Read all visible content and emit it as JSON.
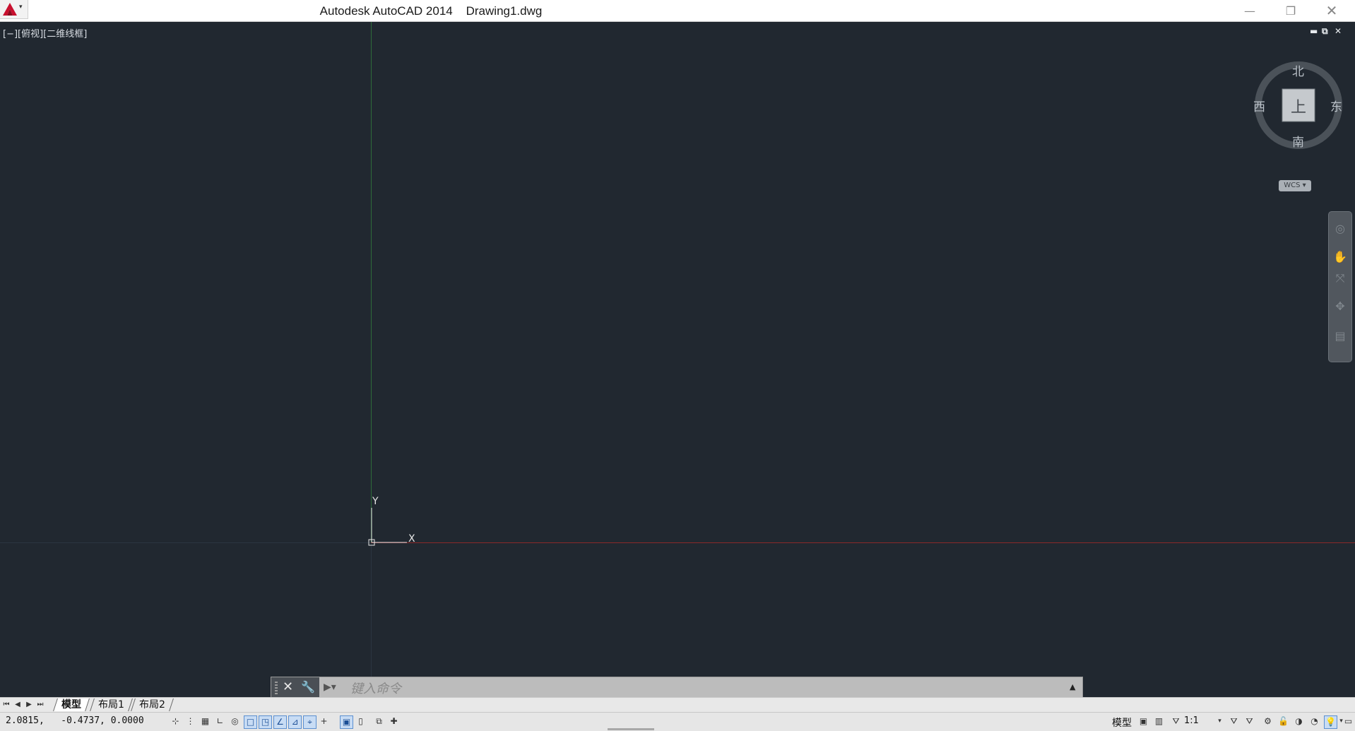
{
  "titlebar": {
    "app_name": "Autodesk AutoCAD 2014",
    "file_name": "Drawing1.dwg",
    "title": "Autodesk AutoCAD 2014    Drawing1.dwg",
    "min_glyph": "—",
    "max_glyph": "❐",
    "close_glyph": "✕"
  },
  "viewport": {
    "label": "[−][俯视][二维线框]",
    "min_glyph": "▬",
    "restore_glyph": "⧉",
    "close_glyph": "✕",
    "ucs": {
      "y_label": "Y",
      "x_label": "X"
    }
  },
  "viewcube": {
    "north": "北",
    "south": "南",
    "east": "东",
    "west": "西",
    "face": "上",
    "wcs": "WCS ▾"
  },
  "navbar": {
    "items": [
      "steeringwheel-icon",
      "pan-icon",
      "zoom-icon",
      "orbit-icon",
      "showmotion-icon"
    ]
  },
  "commandline": {
    "placeholder": "键入命令",
    "close_glyph": "✕",
    "wrench_glyph": "🔧",
    "prompt_glyph": "▶▾",
    "history_glyph": "▲"
  },
  "layout_tabs": {
    "nav": [
      "⏮",
      "◀",
      "▶",
      "⏭"
    ],
    "tabs": [
      "模型",
      "布局1",
      "布局2"
    ],
    "active": "模型"
  },
  "statusbar": {
    "coordinates": "2.0815,   -0.4737, 0.0000",
    "mode_label": "模型",
    "annotation_scale": "1:1",
    "buttons": [
      {
        "name": "infer-constraints",
        "glyph": "⊹",
        "on": false
      },
      {
        "name": "snap-mode",
        "glyph": "⋮",
        "on": false
      },
      {
        "name": "grid-display",
        "glyph": "▦",
        "on": false
      },
      {
        "name": "ortho-mode",
        "glyph": "∟",
        "on": false
      },
      {
        "name": "polar-tracking",
        "glyph": "◎",
        "on": false
      },
      {
        "name": "object-snap",
        "glyph": "□",
        "on": true
      },
      {
        "name": "3d-object-snap",
        "glyph": "◳",
        "on": true
      },
      {
        "name": "object-snap-tracking",
        "glyph": "∠",
        "on": true
      },
      {
        "name": "dynamic-ucs",
        "glyph": "⊿",
        "on": true
      },
      {
        "name": "dynamic-input",
        "glyph": "⌖",
        "on": true
      },
      {
        "name": "lineweight",
        "glyph": "+",
        "on": false
      },
      {
        "name": "transparency",
        "glyph": "▣",
        "on": true
      },
      {
        "name": "quick-properties",
        "glyph": "▯",
        "on": false
      },
      {
        "name": "selection-cycling",
        "glyph": "⧉",
        "on": false
      },
      {
        "name": "annotation-monitor",
        "glyph": "✚",
        "on": false
      }
    ],
    "accent": "#5b8fd0"
  },
  "colors": {
    "canvas": "#212830",
    "x_axis": "#8b2a2a",
    "y_axis": "#2e6b3a",
    "ucs": "#e6e6e6"
  }
}
